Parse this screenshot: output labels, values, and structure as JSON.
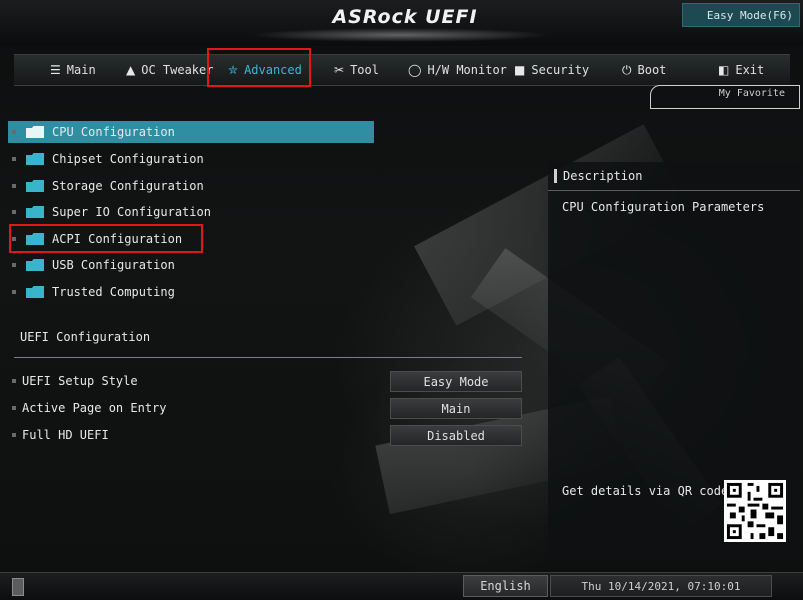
{
  "header": {
    "logo": "ASRock UEFI",
    "easy_mode": "Easy Mode(F6)"
  },
  "tabs": [
    {
      "label": "Main",
      "icon": "list-icon"
    },
    {
      "label": "OC Tweaker",
      "icon": "rocket-icon"
    },
    {
      "label": "Advanced",
      "icon": "star-icon",
      "active": true
    },
    {
      "label": "Tool",
      "icon": "tools-icon"
    },
    {
      "label": "H/W Monitor",
      "icon": "monitor-icon"
    },
    {
      "label": "Security",
      "icon": "shield-icon"
    },
    {
      "label": "Boot",
      "icon": "power-icon"
    },
    {
      "label": "Exit",
      "icon": "exit-icon"
    }
  ],
  "my_favorite": "My Favorite",
  "menu": [
    {
      "label": "CPU Configuration",
      "selected": true
    },
    {
      "label": "Chipset Configuration"
    },
    {
      "label": "Storage Configuration"
    },
    {
      "label": "Super IO Configuration"
    },
    {
      "label": "ACPI Configuration"
    },
    {
      "label": "USB Configuration"
    },
    {
      "label": "Trusted Computing"
    }
  ],
  "uefi_section": {
    "title": "UEFI Configuration",
    "options": [
      {
        "label": "UEFI Setup Style",
        "value": "Easy Mode"
      },
      {
        "label": "Active Page on Entry",
        "value": "Main"
      },
      {
        "label": "Full HD UEFI",
        "value": "Disabled"
      }
    ]
  },
  "description": {
    "title": "Description",
    "text": "CPU Configuration Parameters",
    "qr_text": "Get details via QR code"
  },
  "footer": {
    "language": "English",
    "datetime": "Thu 10/14/2021, 07:10:01"
  },
  "colors": {
    "accent": "#2f8ea1",
    "highlight_box": "#e01818"
  }
}
